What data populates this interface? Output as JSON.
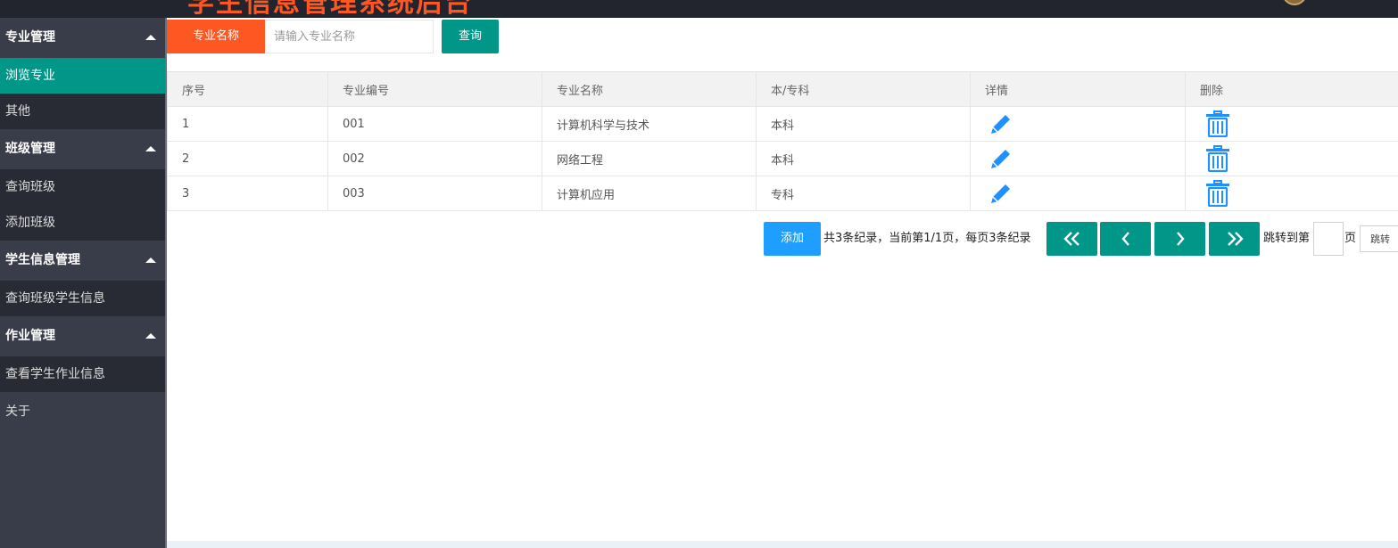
{
  "header": {
    "app_title": "学生信息管理系统后台"
  },
  "sidebar": {
    "groups": [
      {
        "label": "专业管理",
        "items": [
          "浏览专业",
          "其他"
        ]
      },
      {
        "label": "班级管理",
        "items": [
          "查询班级",
          "添加班级"
        ]
      },
      {
        "label": "学生信息管理",
        "items": [
          "查询班级学生信息"
        ]
      },
      {
        "label": "作业管理",
        "items": [
          "查看学生作业信息"
        ]
      }
    ],
    "active_item": "浏览专业",
    "footer_item": "关于"
  },
  "search": {
    "label": "专业名称",
    "placeholder": "请输入专业名称",
    "button": "查询"
  },
  "table": {
    "headers": [
      "序号",
      "专业编号",
      "专业名称",
      "本/专科",
      "详情",
      "删除"
    ],
    "rows": [
      {
        "no": "1",
        "code": "001",
        "name": "计算机科学与技术",
        "level": "本科"
      },
      {
        "no": "2",
        "code": "002",
        "name": "网络工程",
        "level": "本科"
      },
      {
        "no": "3",
        "code": "003",
        "name": "计算机应用",
        "level": "专科"
      }
    ],
    "detail_icon": "pencil-icon",
    "delete_icon": "trash-icon"
  },
  "pager": {
    "add_button": "添加",
    "summary": "共3条纪录，当前第1/1页，每页3条纪录",
    "jump_label": "跳转到第",
    "jump_unit": "页",
    "jump_button": "跳转"
  },
  "colors": {
    "accent_orange": "#ff5722",
    "accent_teal": "#009688",
    "accent_blue": "#1e9fff",
    "icon_blue": "#1e90ff"
  }
}
